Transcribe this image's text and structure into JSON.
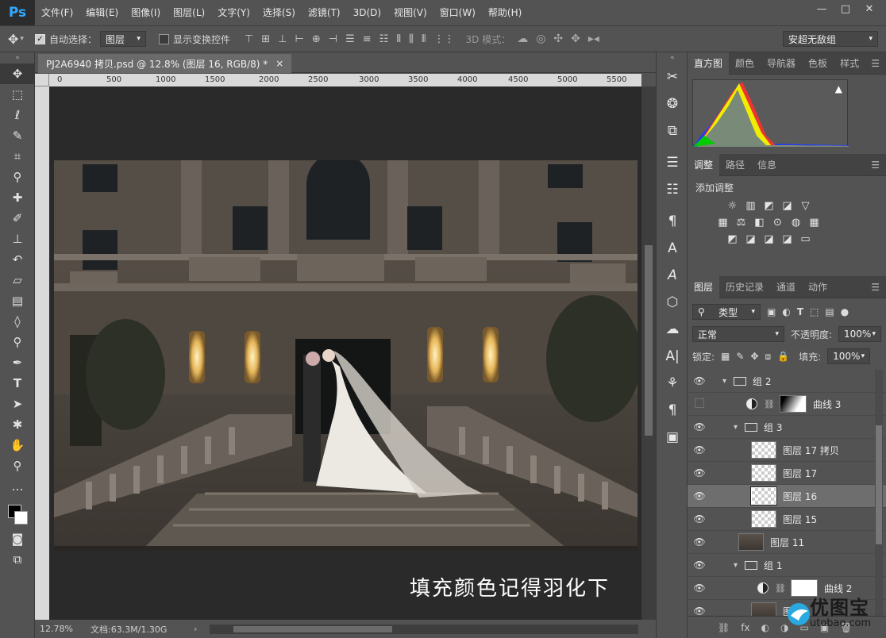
{
  "app": {
    "logo": "Ps"
  },
  "menu": [
    "文件(F)",
    "编辑(E)",
    "图像(I)",
    "图层(L)",
    "文字(Y)",
    "选择(S)",
    "滤镜(T)",
    "3D(D)",
    "视图(V)",
    "窗口(W)",
    "帮助(H)"
  ],
  "window_controls": {
    "minimize": "—",
    "maximize": "□",
    "close": "✕"
  },
  "options": {
    "auto_select_label": "自动选择：",
    "auto_select_checked": true,
    "auto_select_value": "图层",
    "show_transform_label": "显示变换控件",
    "mode_3d_label": "3D 模式：",
    "font_select": "安超无敌组"
  },
  "document": {
    "tab_title": "PJ2A6940 拷贝.psd @ 12.8% (图层 16, RGB/8) *",
    "tab_close": "×",
    "ruler_ticks": [
      "0",
      "500",
      "1000",
      "1500",
      "2000",
      "2500",
      "3000",
      "3500",
      "4000",
      "4500",
      "5000",
      "5500"
    ],
    "caption": "填充颜色记得羽化下",
    "zoom": "12.78%",
    "doc_info": "文档:63.3M/1.30G",
    "status_arrow": "›"
  },
  "panels": {
    "top_tabs": [
      "直方图",
      "颜色",
      "导航器",
      "色板",
      "样式"
    ],
    "adjust_tabs": [
      "调整",
      "路径",
      "信息"
    ],
    "adjust_title": "添加调整",
    "adjust_icons_row1": [
      "☼",
      "▥",
      "◩",
      "◪",
      "▽"
    ],
    "adjust_icons_row2": [
      "▦",
      "⚖",
      "◧",
      "⊙",
      "◍",
      "▦"
    ],
    "adjust_icons_row3": [
      "◩",
      "◪",
      "◪",
      "◪",
      "▭"
    ],
    "layers_tabs": [
      "图层",
      "历史记录",
      "通道",
      "动作"
    ],
    "filter_type": "类型",
    "blend_mode": "正常",
    "opacity_label": "不透明度:",
    "opacity_value": "100%",
    "lock_label": "锁定:",
    "fill_label": "填充:",
    "fill_value": "100%",
    "layers": [
      {
        "name": "组 2",
        "kind": "group",
        "indent": 1,
        "visible": true
      },
      {
        "name": "曲线 3",
        "kind": "curves-grad",
        "indent": 2,
        "visible": false
      },
      {
        "name": "组 3",
        "kind": "group",
        "indent": 2,
        "visible": true
      },
      {
        "name": "图层 17 拷贝",
        "kind": "layer",
        "indent": 3,
        "visible": true
      },
      {
        "name": "图层 17",
        "kind": "layer",
        "indent": 3,
        "visible": true
      },
      {
        "name": "图层 16",
        "kind": "layer",
        "indent": 3,
        "visible": true,
        "selected": true
      },
      {
        "name": "图层 15",
        "kind": "layer",
        "indent": 3,
        "visible": true
      },
      {
        "name": "图层 11",
        "kind": "photo",
        "indent": 2,
        "visible": true
      },
      {
        "name": "组 1",
        "kind": "group",
        "indent": 2,
        "visible": true
      },
      {
        "name": "曲线 2",
        "kind": "curves-white",
        "indent": 3,
        "visible": true
      },
      {
        "name": "图层",
        "kind": "photo",
        "indent": 3,
        "visible": true
      }
    ],
    "footer_icons": [
      "⛓",
      "fx",
      "◐",
      "◑",
      "▭",
      "▣",
      "🗑"
    ]
  },
  "watermark": {
    "title": "优图宝",
    "url": "utobao.com"
  }
}
